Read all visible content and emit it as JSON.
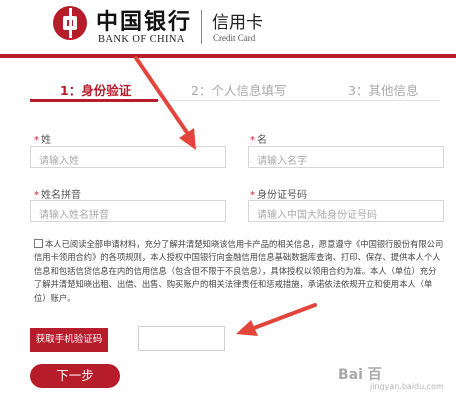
{
  "header": {
    "brand_cn": "中国银行",
    "brand_en": "BANK OF CHINA",
    "product_cn": "信用卡",
    "product_en": "Credit Card"
  },
  "steps": [
    {
      "label": "1：身份验证",
      "active": true
    },
    {
      "label": "2：个人信息填写",
      "active": false
    },
    {
      "label": "3：其他信息",
      "active": false
    }
  ],
  "form": {
    "surname": {
      "label": "姓",
      "placeholder": "请输入姓"
    },
    "given_name": {
      "label": "名",
      "placeholder": "请输入名字"
    },
    "pinyin": {
      "label": "姓名拼音",
      "placeholder": "请输入姓名拼音"
    },
    "id_number": {
      "label": "身份证号码",
      "placeholder": "请输入中国大陆身份证号码"
    },
    "required_mark": "*"
  },
  "agreement_text": "本人已阅读全部申请材料，充分了解并清楚知晓该信用卡产品的相关信息，愿意遵守《中国银行股份有限公司信用卡领用合约》的各项规则，本人授权中国银行向金融信用信息基础数据库查询、打印、保存、提供本人个人信息和包括信贷信息在内的信用信息（包含但不限于不良信息），具体授权以领用合约为准。本人（单位）充分了解并清楚知晓出租、出借、出售、购买账户的相关法律责任和惩戒措施，承诺依法依规开立和使用本人（单位）账户。",
  "sms_button": "获取手机验证码",
  "next_button": "下一步",
  "watermark": {
    "main": "Bai 百",
    "sub": "jingyan.baidu.com"
  },
  "colors": {
    "accent": "#b71c2b",
    "arrow": "#e2453c"
  }
}
